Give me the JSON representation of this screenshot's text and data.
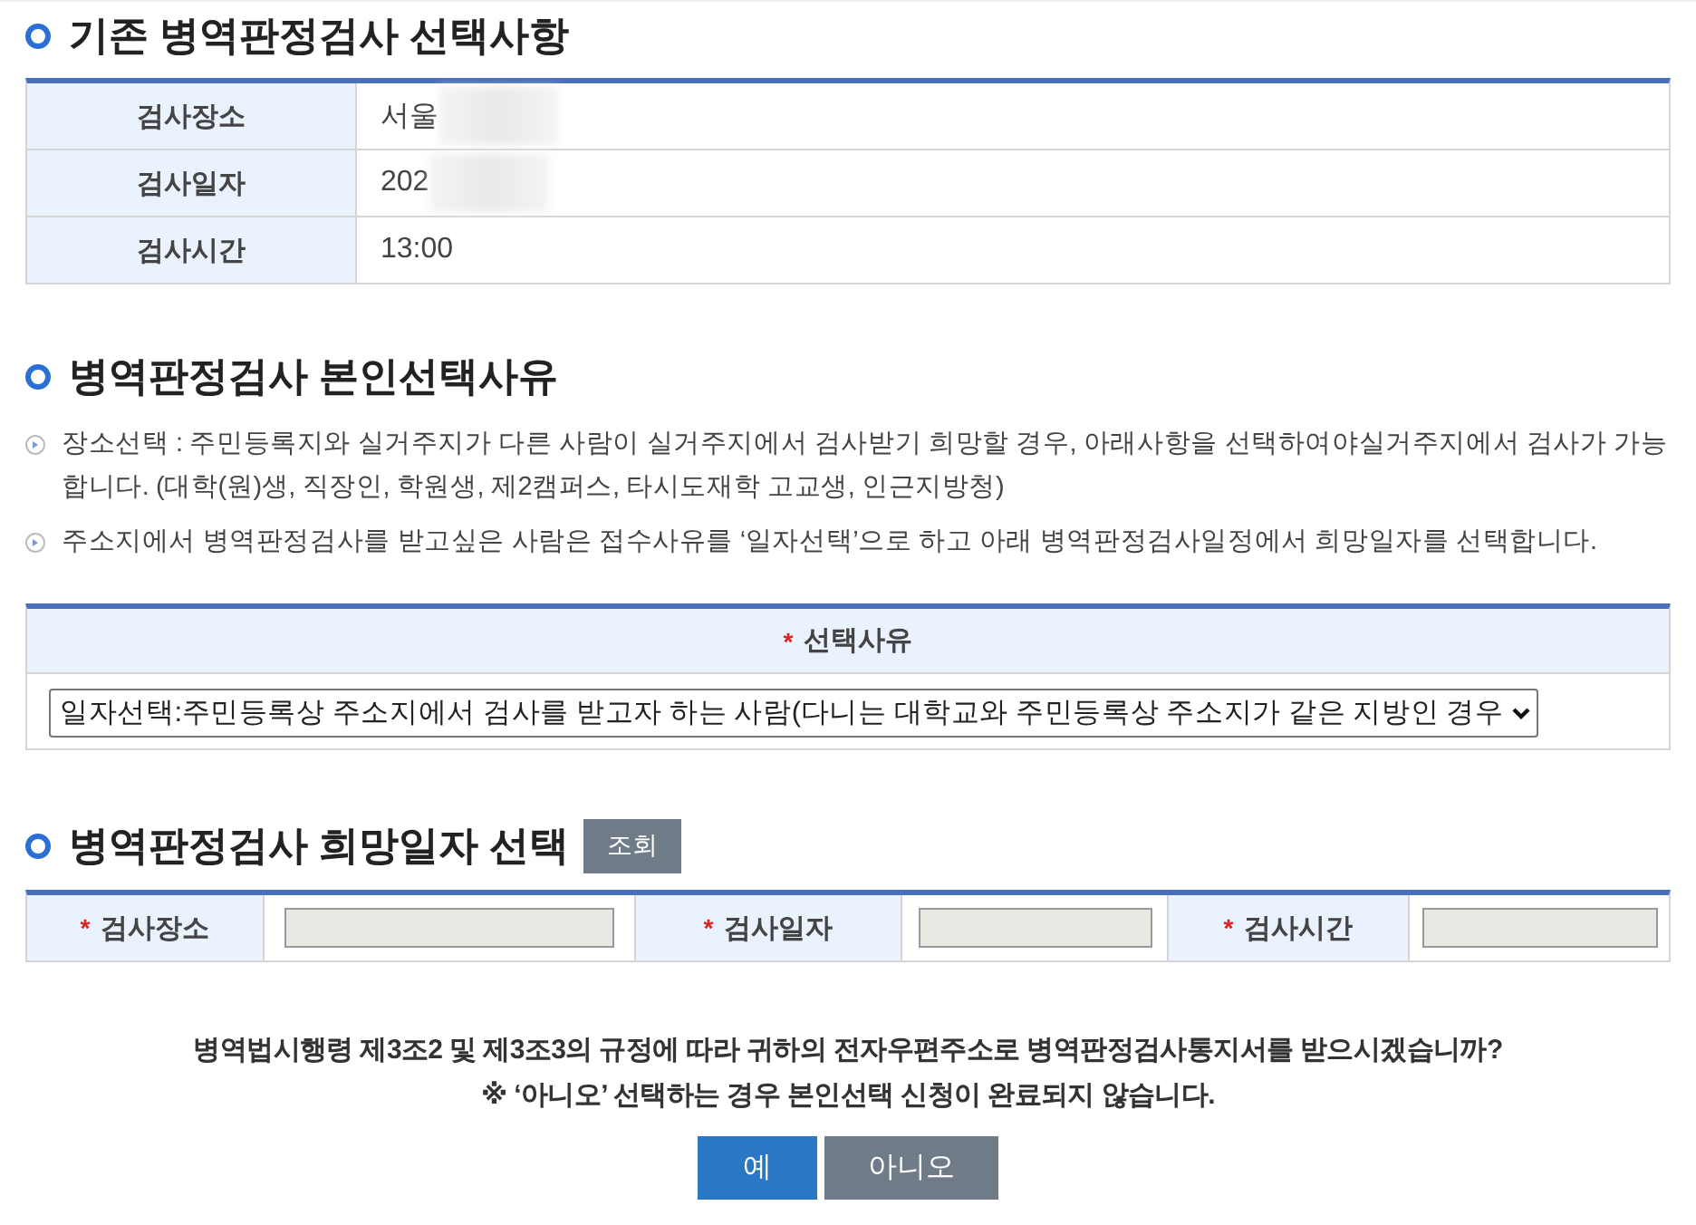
{
  "existing_selection": {
    "title": "기존 병역판정검사 선택사항",
    "rows": [
      {
        "label": "검사장소",
        "value": "서울",
        "redacted": true
      },
      {
        "label": "검사일자",
        "value": "202",
        "redacted": true
      },
      {
        "label": "검사시간",
        "value": "13:00",
        "redacted": false
      }
    ]
  },
  "reason_section": {
    "title": "병역판정검사 본인선택사유",
    "notes": [
      "장소선택 : 주민등록지와 실거주지가 다른 사람이 실거주지에서 검사받기 희망할 경우, 아래사항을 선택하여야실거주지에서 검사가 가능합니다. (대학(원)생, 직장인, 학원생, 제2캠퍼스, 타시도재학 고교생, 인근지방청)",
      "주소지에서 병역판정검사를 받고싶은 사람은 접수사유를 ‘일자선택’으로 하고 아래 병역판정검사일정에서 희망일자를 선택합니다."
    ],
    "field": {
      "label": "선택사유",
      "required_mark": "*",
      "value": "일자선택:주민등록상 주소지에서 검사를 받고자 하는 사람(다니는 대학교와 주민등록상 주소지가 같은 지방인 경우"
    }
  },
  "desired_date_section": {
    "title": "병역판정검사 희망일자 선택",
    "lookup_button": "조회",
    "fields": [
      {
        "label": "검사장소",
        "required_mark": "*",
        "disabled": true
      },
      {
        "label": "검사일자",
        "required_mark": "*",
        "disabled": true
      },
      {
        "label": "검사시간",
        "required_mark": "*",
        "disabled": true
      }
    ]
  },
  "confirmation": {
    "lines": [
      "병역법시행령 제3조2 및 제3조3의 규정에 따라 귀하의 전자우편주소로 병역판정검사통지서를 받으시겠습니까?",
      "※ ‘아니오’ 선택하는 경우 본인선택 신청이 완료되지 않습니다."
    ],
    "buttons": [
      {
        "label": "예",
        "kind": "primary"
      },
      {
        "label": "아니오",
        "kind": "secondary"
      }
    ]
  }
}
